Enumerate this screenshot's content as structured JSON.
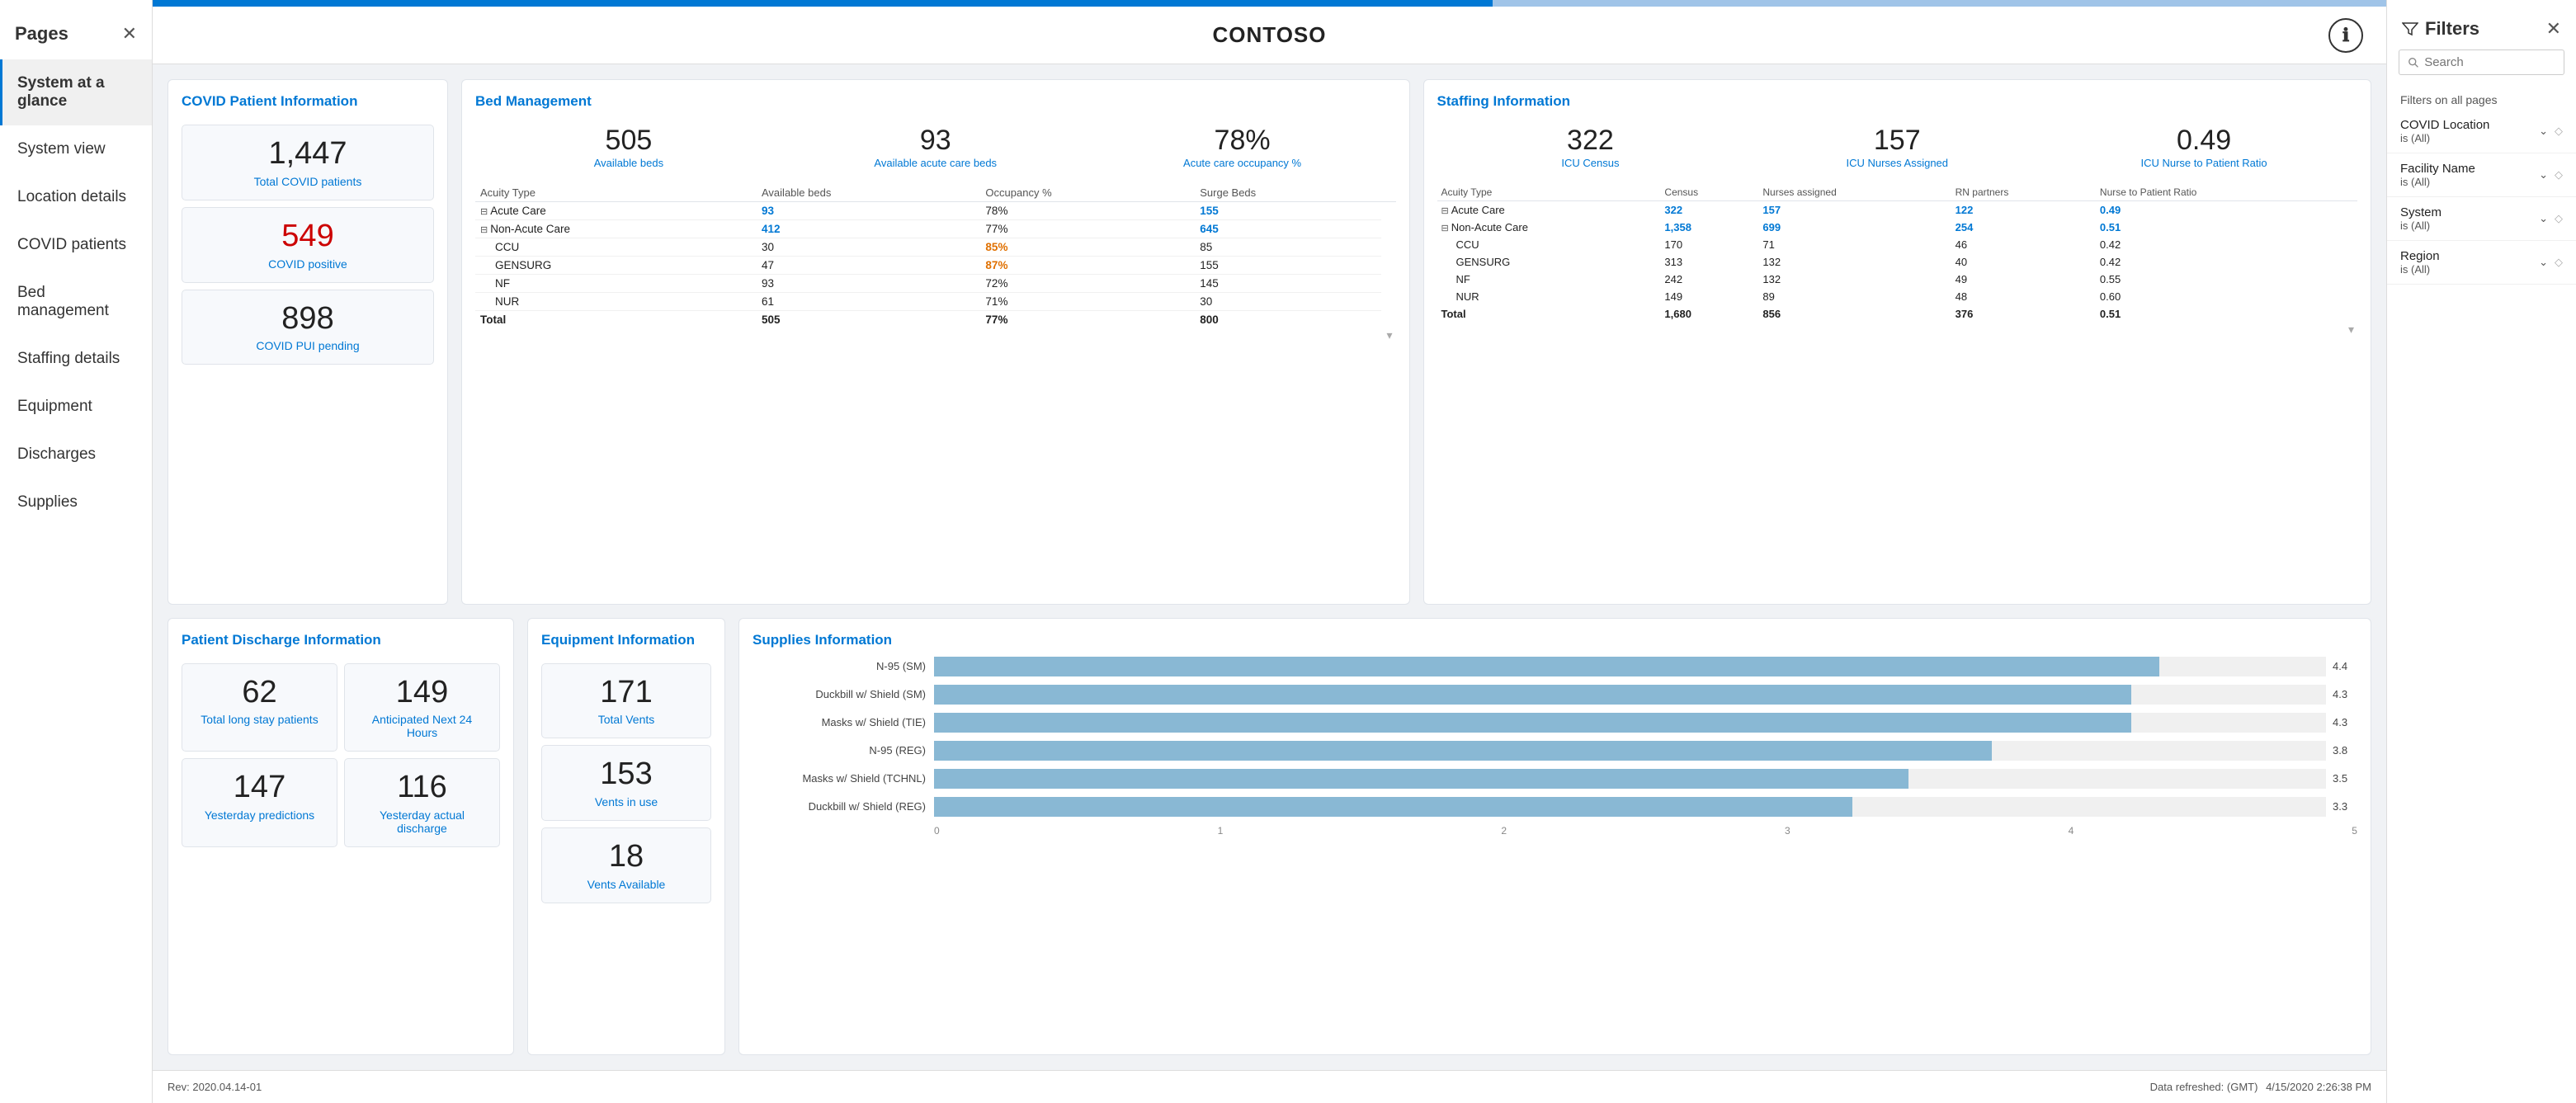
{
  "sidebar": {
    "title": "Pages",
    "items": [
      {
        "id": "system-at-a-glance",
        "label": "System at a glance",
        "active": true
      },
      {
        "id": "system-view",
        "label": "System view",
        "active": false
      },
      {
        "id": "location-details",
        "label": "Location details",
        "active": false
      },
      {
        "id": "covid-patients",
        "label": "COVID patients",
        "active": false
      },
      {
        "id": "bed-management",
        "label": "Bed management",
        "active": false
      },
      {
        "id": "staffing-details",
        "label": "Staffing details",
        "active": false
      },
      {
        "id": "equipment",
        "label": "Equipment",
        "active": false
      },
      {
        "id": "discharges",
        "label": "Discharges",
        "active": false
      },
      {
        "id": "supplies",
        "label": "Supplies",
        "active": false
      }
    ]
  },
  "topbar": {
    "title": "CONTOSO"
  },
  "covid": {
    "title": "COVID Patient Information",
    "total": "1,447",
    "total_label": "Total COVID patients",
    "positive": "549",
    "positive_label": "COVID positive",
    "pui": "898",
    "pui_label": "COVID PUI pending"
  },
  "bed": {
    "title": "Bed Management",
    "available": "505",
    "available_label": "Available beds",
    "acute": "93",
    "acute_label": "Available acute care beds",
    "occupancy": "78%",
    "occupancy_label": "Acute care occupancy %",
    "columns": [
      "Acuity Type",
      "Available beds",
      "Occupancy %",
      "Surge Beds"
    ],
    "rows": [
      {
        "type": "Acute Care",
        "expand": true,
        "available": "93",
        "occupancy": "78%",
        "surge": "155",
        "occ_color": "normal"
      },
      {
        "type": "Non-Acute Care",
        "expand": true,
        "available": "412",
        "occupancy": "77%",
        "surge": "645",
        "occ_color": "normal"
      },
      {
        "type": "CCU",
        "expand": false,
        "available": "30",
        "occupancy": "85%",
        "surge": "85",
        "occ_color": "orange"
      },
      {
        "type": "GENSURG",
        "expand": false,
        "available": "47",
        "occupancy": "87%",
        "surge": "155",
        "occ_color": "orange"
      },
      {
        "type": "NF",
        "expand": false,
        "available": "93",
        "occupancy": "72%",
        "surge": "145",
        "occ_color": "normal"
      },
      {
        "type": "NUR",
        "expand": false,
        "available": "61",
        "occupancy": "71%",
        "surge": "30",
        "occ_color": "normal"
      },
      {
        "type": "Total",
        "expand": false,
        "available": "505",
        "occupancy": "77%",
        "surge": "800",
        "occ_color": "normal",
        "bold": true
      }
    ]
  },
  "staffing": {
    "title": "Staffing Information",
    "icu_census": "322",
    "icu_census_label": "ICU Census",
    "icu_nurses": "157",
    "icu_nurses_label": "ICU Nurses Assigned",
    "nurse_ratio": "0.49",
    "nurse_ratio_label": "ICU Nurse to Patient Ratio",
    "columns": [
      "Acuity Type",
      "Census",
      "Nurses assigned",
      "RN partners",
      "Nurse to Patient Ratio"
    ],
    "rows": [
      {
        "type": "Acute Care",
        "expand": true,
        "census": "322",
        "nurses": "157",
        "rn": "122",
        "ratio": "0.49",
        "blue": true
      },
      {
        "type": "Non-Acute Care",
        "expand": true,
        "census": "1,358",
        "nurses": "699",
        "rn": "254",
        "ratio": "0.51",
        "blue": true
      },
      {
        "type": "CCU",
        "expand": false,
        "census": "170",
        "nurses": "71",
        "rn": "46",
        "ratio": "0.42",
        "blue": false
      },
      {
        "type": "GENSURG",
        "expand": false,
        "census": "313",
        "nurses": "132",
        "rn": "40",
        "ratio": "0.42",
        "blue": false
      },
      {
        "type": "NF",
        "expand": false,
        "census": "242",
        "nurses": "132",
        "rn": "49",
        "ratio": "0.55",
        "blue": false
      },
      {
        "type": "NUR",
        "expand": false,
        "census": "149",
        "nurses": "89",
        "rn": "48",
        "ratio": "0.60",
        "blue": false
      },
      {
        "type": "Total",
        "expand": false,
        "census": "1,680",
        "nurses": "856",
        "rn": "376",
        "ratio": "0.51",
        "bold": true,
        "blue": false
      }
    ]
  },
  "discharge": {
    "title": "Patient Discharge Information",
    "metrics": [
      {
        "value": "62",
        "label": "Total long stay patients"
      },
      {
        "value": "149",
        "label": "Anticipated Next 24 Hours"
      },
      {
        "value": "147",
        "label": "Yesterday predictions"
      },
      {
        "value": "116",
        "label": "Yesterday actual discharge"
      }
    ]
  },
  "equipment": {
    "title": "Equipment Information",
    "metrics": [
      {
        "value": "171",
        "label": "Total Vents"
      },
      {
        "value": "153",
        "label": "Vents in use"
      },
      {
        "value": "18",
        "label": "Vents Available"
      }
    ]
  },
  "supplies": {
    "title": "Supplies Information",
    "bars": [
      {
        "label": "N-95 (SM)",
        "value": 4.4,
        "max": 5
      },
      {
        "label": "Duckbill w/ Shield (SM)",
        "value": 4.3,
        "max": 5
      },
      {
        "label": "Masks w/ Shield (TIE)",
        "value": 4.3,
        "max": 5
      },
      {
        "label": "N-95 (REG)",
        "value": 3.8,
        "max": 5
      },
      {
        "label": "Masks w/ Shield (TCHNL)",
        "value": 3.5,
        "max": 5
      },
      {
        "label": "Duckbill w/ Shield (REG)",
        "value": 3.3,
        "max": 5
      }
    ],
    "axis": [
      "0",
      "1",
      "2",
      "3",
      "4",
      "5"
    ]
  },
  "footer": {
    "rev": "Rev: 2020.04.14-01",
    "refresh": "Data refreshed: (GMT)",
    "timestamp": "4/15/2020 2:26:38 PM"
  },
  "filters": {
    "title": "Filters",
    "search_placeholder": "Search",
    "section_label": "Filters on all pages",
    "items": [
      {
        "title": "COVID Location",
        "sub": "is (All)"
      },
      {
        "title": "Facility Name",
        "sub": "is (All)"
      },
      {
        "title": "System",
        "sub": "is (All)"
      },
      {
        "title": "Region",
        "sub": "is (All)"
      }
    ]
  }
}
